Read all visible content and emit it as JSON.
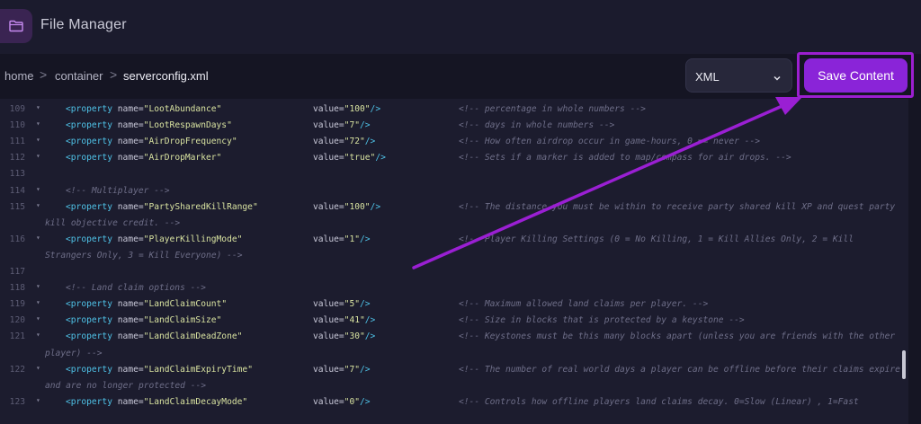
{
  "app": {
    "title": "File Manager",
    "icon": "folder-icon"
  },
  "breadcrumb": {
    "items": [
      "home",
      "container",
      "serverconfig.xml"
    ],
    "separator": ">"
  },
  "language_select": {
    "value": "XML"
  },
  "save_button": {
    "label": "Save Content"
  },
  "colors": {
    "accent": "#8a24d8",
    "highlight": "#9c1fd0",
    "tag": "#4fc3e8",
    "string": "#d8e2a0",
    "comment": "#6e6e88"
  },
  "editor": {
    "lines": [
      {
        "num": "109",
        "fold": true,
        "name": "LootAbundance",
        "value": "100",
        "comment": "<!-- percentage in whole numbers -->",
        "cont": ""
      },
      {
        "num": "110",
        "fold": true,
        "name": "LootRespawnDays",
        "value": "7",
        "comment": "<!-- days in whole numbers -->",
        "cont": ""
      },
      {
        "num": "111",
        "fold": true,
        "name": "AirDropFrequency",
        "value": "72",
        "comment": "<!-- How often airdrop occur in game-hours, 0 == never -->",
        "cont": ""
      },
      {
        "num": "112",
        "fold": true,
        "name": "AirDropMarker",
        "value": "true",
        "comment": "<!-- Sets if a marker is added to map/compass for air drops. -->",
        "cont": ""
      },
      {
        "num": "113",
        "fold": false,
        "blank": true
      },
      {
        "num": "114",
        "fold": true,
        "section": "<!-- Multiplayer -->"
      },
      {
        "num": "115",
        "fold": true,
        "name": "PartySharedKillRange",
        "value": "100",
        "comment": "<!-- The distance you must be within to receive party shared kill XP and quest party",
        "cont": "kill objective credit. -->"
      },
      {
        "num": "116",
        "fold": true,
        "name": "PlayerKillingMode",
        "value": "1",
        "comment": "<!-- Player Killing Settings (0 = No Killing, 1 = Kill Allies Only, 2 = Kill",
        "cont": "Strangers Only, 3 = Kill Everyone) -->"
      },
      {
        "num": "117",
        "fold": false,
        "blank": true
      },
      {
        "num": "118",
        "fold": true,
        "section": "<!-- Land claim options -->"
      },
      {
        "num": "119",
        "fold": true,
        "name": "LandClaimCount",
        "value": "5",
        "comment": "<!-- Maximum allowed land claims per player. -->",
        "cont": ""
      },
      {
        "num": "120",
        "fold": true,
        "name": "LandClaimSize",
        "value": "41",
        "comment": "<!-- Size in blocks that is protected by a keystone -->",
        "cont": ""
      },
      {
        "num": "121",
        "fold": true,
        "name": "LandClaimDeadZone",
        "value": "30",
        "comment": "<!-- Keystones must be this many blocks apart (unless you are friends with the other",
        "cont": "player) -->"
      },
      {
        "num": "122",
        "fold": true,
        "name": "LandClaimExpiryTime",
        "value": "7",
        "comment": "<!-- The number of real world days a player can be offline before their claims expire",
        "cont": "and are no longer protected -->"
      },
      {
        "num": "123",
        "fold": true,
        "name": "LandClaimDecayMode",
        "value": "0",
        "comment": "<!-- Controls how offline players land claims decay. 0=Slow (Linear) , 1=Fast",
        "cont": ""
      }
    ]
  }
}
